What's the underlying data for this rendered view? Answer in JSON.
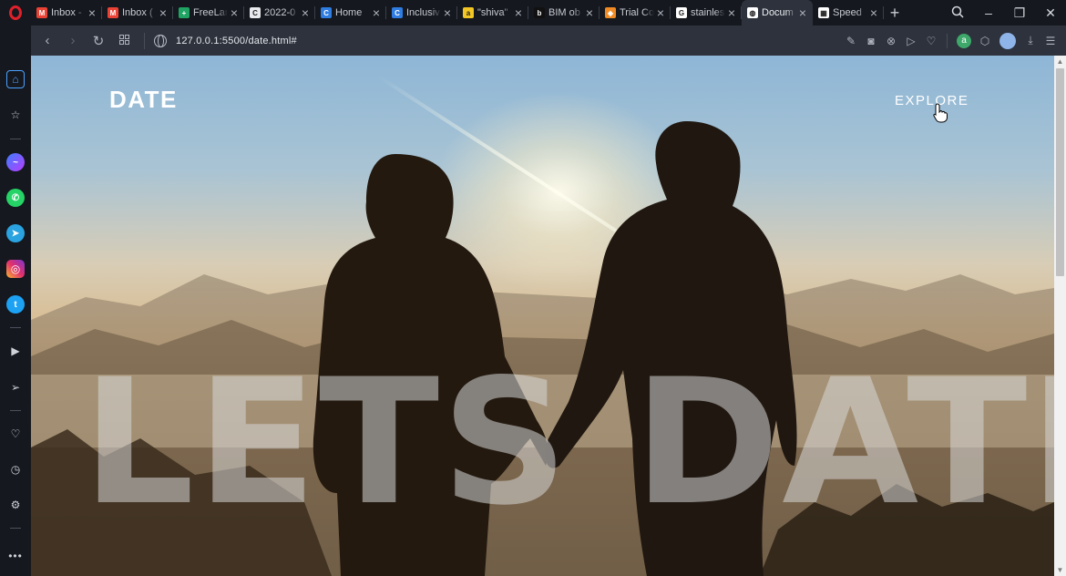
{
  "browser": {
    "tabs": [
      {
        "title": "Inbox -",
        "favicon": "gmail-icon",
        "color": "#ea4335",
        "glyph": "M"
      },
      {
        "title": "Inbox (",
        "favicon": "gmail-icon",
        "color": "#ea4335",
        "glyph": "M"
      },
      {
        "title": "FreeLar",
        "favicon": "sheets-icon",
        "color": "#1fa463",
        "glyph": "+"
      },
      {
        "title": "2022-0",
        "favicon": "docs-icon",
        "color": "#e8eaed",
        "glyph": "C"
      },
      {
        "title": "Home",
        "favicon": "canva-icon",
        "color": "#2f7de1",
        "glyph": "C"
      },
      {
        "title": "Inclusiv",
        "favicon": "canva-icon",
        "color": "#2f7de1",
        "glyph": "C"
      },
      {
        "title": "\"shiva\"",
        "favicon": "amazon-icon",
        "color": "#f3c623",
        "glyph": "a"
      },
      {
        "title": "BIM ob",
        "favicon": "bim-icon",
        "color": "#111111",
        "glyph": "b"
      },
      {
        "title": "Trial Co",
        "favicon": "shield-icon",
        "color": "#f08a24",
        "glyph": "◈"
      },
      {
        "title": "stainles",
        "favicon": "google-icon",
        "color": "#ffffff",
        "glyph": "G"
      },
      {
        "title": "Docum",
        "favicon": "globe-icon",
        "color": "#ffffff",
        "glyph": "◍"
      },
      {
        "title": "Speed",
        "favicon": "speed-dial-icon",
        "color": "#ffffff",
        "glyph": "▦"
      }
    ],
    "new_tab": "+",
    "url": "127.0.0.1:5500/date.html#"
  },
  "page": {
    "logo": "DATE",
    "nav_explore": "EXPLORE",
    "hero": "LETS DATE"
  },
  "colors": {
    "opera_red": "#e0202a",
    "tab_bar": "#15181e",
    "toolbar": "#2d323c",
    "hero_overlay": "rgba(215,215,215,0.55)"
  },
  "sidebar_icons": [
    "home-icon",
    "speed-dial-star-icon",
    "messenger-icon",
    "whatsapp-icon",
    "telegram-icon",
    "instagram-icon",
    "twitter-icon",
    "player-icon",
    "send-icon",
    "heart-icon",
    "history-icon",
    "settings-icon",
    "more-icon"
  ]
}
